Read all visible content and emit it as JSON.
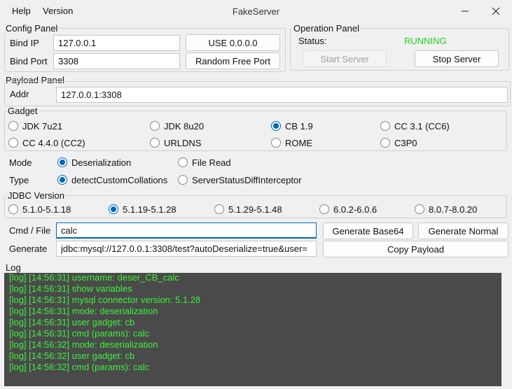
{
  "window": {
    "title": "FakeServer"
  },
  "menu": {
    "help": "Help",
    "version": "Version"
  },
  "config": {
    "title": "Config Panel",
    "bind_ip_label": "Bind IP",
    "bind_ip_value": "127.0.0.1",
    "use_all_label": "USE 0.0.0.0",
    "bind_port_label": "Bind Port",
    "bind_port_value": "3308",
    "random_port_label": "Random Free Port"
  },
  "operation": {
    "title": "Operation Panel",
    "status_label": "Status:",
    "status_value": "RUNNING",
    "status_color": "#22d022",
    "start_label": "Start Server",
    "stop_label": "Stop Server"
  },
  "payload": {
    "title": "Payload Panel",
    "addr_label": "Addr",
    "addr_value": "127.0.0.1:3308",
    "gadget_title": "Gadget",
    "gadgets": [
      "JDK 7u21",
      "JDK 8u20",
      "CB 1.9",
      "CC 3.1 (CC6)",
      "CC 4.4.0 (CC2)",
      "URLDNS",
      "ROME",
      "C3P0"
    ],
    "gadget_selected": "CB 1.9",
    "mode_label": "Mode",
    "modes": [
      "Deserialization",
      "File Read"
    ],
    "mode_selected": "Deserialization",
    "type_label": "Type",
    "types": [
      "detectCustomCollations",
      "ServerStatusDiffInterceptor"
    ],
    "type_selected": "detectCustomCollations",
    "jdbc_title": "JDBC Version",
    "jdbc_versions": [
      "5.1.0-5.1.18",
      "5.1.19-5.1.28",
      "5.1.29-5.1.48",
      "6.0.2-6.0.6",
      "8.0.7-8.0.20"
    ],
    "jdbc_selected": "5.1.19-5.1.28",
    "cmd_label": "Cmd / File",
    "cmd_value": "calc",
    "gen_base64_label": "Generate Base64",
    "gen_normal_label": "Generate Normal",
    "generate_label": "Generate",
    "generate_value": "jdbc:mysql://127.0.0.1:3308/test?autoDeserialize=true&user=",
    "copy_label": "Copy Payload"
  },
  "log": {
    "title": "Log",
    "text_color": "#3cf23c",
    "lines": [
      "[log] [14:56:31] username: deser_CB_calc",
      "[log] [14:56:31] show variables",
      "[log] [14:56:31] mysql connector version: 5.1.28",
      "[log] [14:56:31] mode: deserialization",
      "[log] [14:56:31] user gadget: cb",
      "[log] [14:56:31] cmd (params): calc",
      "[log] [14:56:32] mode: deserialization",
      "[log] [14:56:32] user gadget: cb",
      "[log] [14:56:32] cmd (params): calc"
    ]
  },
  "icons": {
    "minimize": "minimize-icon",
    "close": "close-icon"
  }
}
